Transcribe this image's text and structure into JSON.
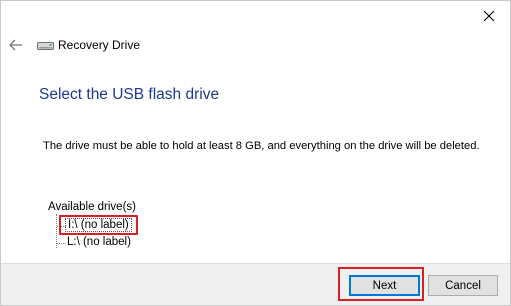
{
  "window": {
    "title": "Recovery Drive",
    "close_icon": "close-icon",
    "back_icon": "back-arrow-icon",
    "app_icon": "drive-icon"
  },
  "page": {
    "heading": "Select the USB flash drive",
    "description": "The drive must be able to hold at least 8 GB, and everything on the drive will be deleted."
  },
  "drives": {
    "label": "Available drive(s)",
    "items": [
      {
        "label": "I:\\ (no label)",
        "selected": true
      },
      {
        "label": "L:\\ (no label)",
        "selected": false
      }
    ]
  },
  "buttons": {
    "next": "Next",
    "cancel": "Cancel"
  },
  "colors": {
    "heading": "#1e3a8c",
    "highlight": "#d81f26",
    "focus": "#0078d7",
    "footer_bg": "#f0f0f0"
  }
}
